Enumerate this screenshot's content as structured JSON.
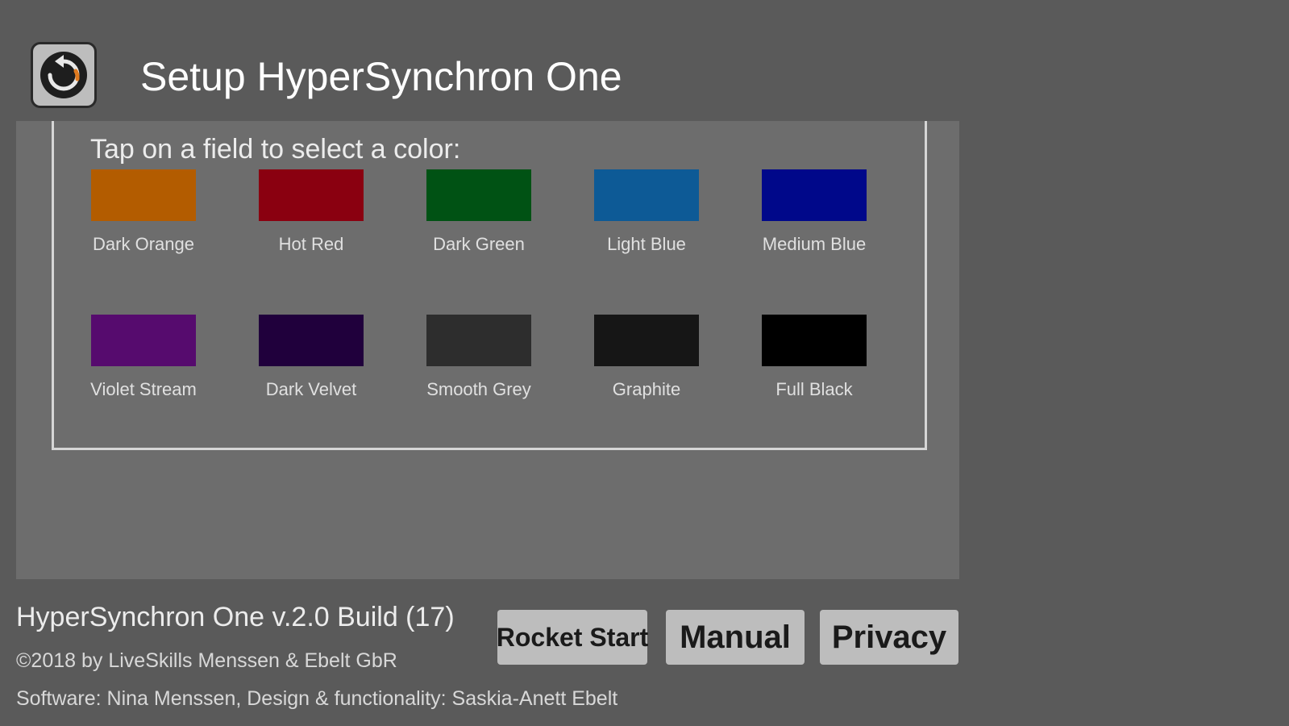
{
  "header": {
    "title": "Setup HyperSynchron One",
    "back_icon": "back-arrow-icon"
  },
  "colors": {
    "instruction": "Tap on a field to select a color:",
    "swatches": [
      {
        "label": "Dark Orange",
        "color": "#b35c00"
      },
      {
        "label": "Hot Red",
        "color": "#8a0010"
      },
      {
        "label": "Dark Green",
        "color": "#005214"
      },
      {
        "label": "Light Blue",
        "color": "#0d5a96"
      },
      {
        "label": "Medium Blue",
        "color": "#00088a"
      },
      {
        "label": "Violet Stream",
        "color": "#560b6e"
      },
      {
        "label": "Dark Velvet",
        "color": "#20003c"
      },
      {
        "label": "Smooth Grey",
        "color": "#2d2d2d"
      },
      {
        "label": "Graphite",
        "color": "#161616"
      },
      {
        "label": "Full Black",
        "color": "#000000"
      }
    ]
  },
  "footer": {
    "version": "HyperSynchron One v.2.0 Build (17)",
    "copyright": "©2018 by LiveSkills Menssen & Ebelt GbR",
    "credits": "Software: Nina Menssen, Design & functionality: Saskia-Anett Ebelt",
    "rocket_start_label": "Rocket Start",
    "manual_label": "Manual",
    "privacy_label": "Privacy"
  }
}
